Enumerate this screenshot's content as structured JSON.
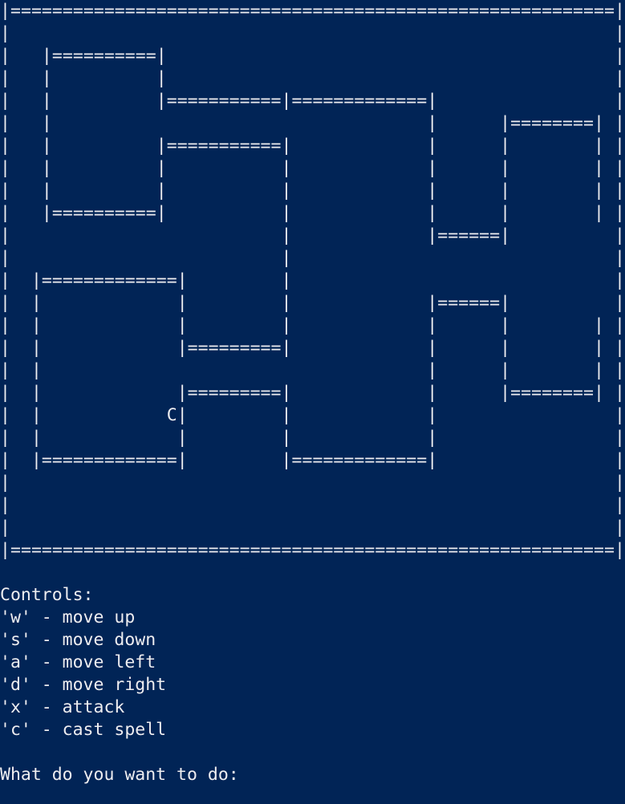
{
  "map": {
    "rows": [
      "|==========================================================|",
      "|                                                          |",
      "|   |==========|                                           |",
      "|   |          |                                           |",
      "|   |          |===========|=============|                 |",
      "|   |                                    |      |========| |",
      "|   |          |===========|             |      |        | |",
      "|   |          |           |             |      |        | |",
      "|   |          |           |             |      |        | |",
      "|   |==========|           |             |      |        | |",
      "|                          |             |======|          |",
      "|                          |                               |",
      "|  |=============|         |                               |",
      "|  |             |         |             |======|          |",
      "|  |             |         |             |      |        | |",
      "|  |             |=========|             |      |        | |",
      "|  |                                     |      |        | |",
      "|  |             |=========|             |      |========| |",
      "|  |            C|         |             |                 |",
      "|  |             |         |             |                 |",
      "|  |=============|         |=============|                 |",
      "|                                                          |",
      "|                                                          |",
      "|                                                          |",
      "|==========================================================|"
    ]
  },
  "controls": {
    "header": "Controls:",
    "items": [
      "'w' - move up",
      "'s' - move down",
      "'a' - move left",
      "'d' - move right",
      "'x' - attack",
      "'c' - cast spell"
    ]
  },
  "prompt": {
    "text": "What do you want to do:"
  }
}
